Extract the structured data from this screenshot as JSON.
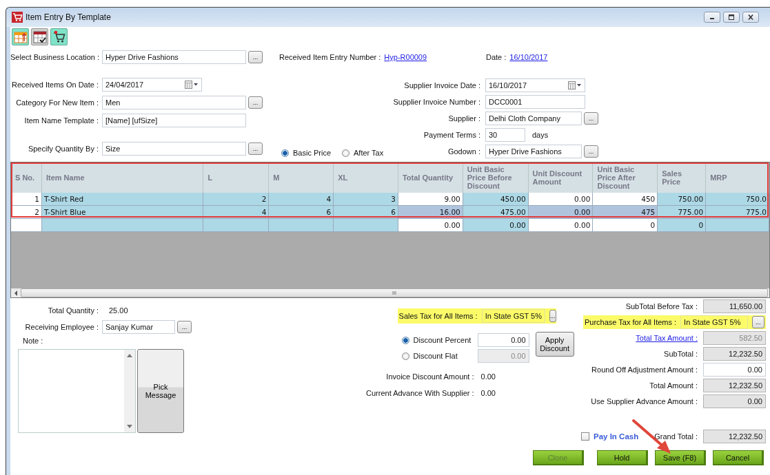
{
  "window": {
    "title": "Item Entry By Template"
  },
  "header_row": {
    "business_location": {
      "label": "Select Business Location :",
      "value": "Hyper Drive Fashions",
      "button": "..."
    },
    "entry_number": {
      "label": "Received Item Entry Number :",
      "value": "Hyp-R00009"
    },
    "date": {
      "label": "Date :",
      "value": "16/10/2017"
    }
  },
  "left_fields": [
    {
      "kind": "date",
      "label": "Received Items On Date :",
      "value": "24/04/2017"
    },
    {
      "kind": "text",
      "label": "Category  For New Item :",
      "value": "Men",
      "button": "..."
    },
    {
      "kind": "text",
      "label": "Item Name Template :",
      "value": "[Name]  [ufSize]"
    },
    {
      "kind": "text",
      "label": "Specify Quantity By :",
      "value": "Size",
      "button": "..."
    }
  ],
  "price_modes": [
    {
      "label": "Basic Price",
      "selected": true
    },
    {
      "label": "After Tax",
      "selected": false
    }
  ],
  "right_fields": [
    {
      "kind": "date",
      "label": "Supplier Invoice Date :",
      "value": "16/10/2017"
    },
    {
      "kind": "text",
      "label": "Supplier Invoice Number :",
      "value": "DCC0001"
    },
    {
      "kind": "text",
      "label": "Supplier :",
      "value": "Delhi Cloth Company",
      "button": "..."
    },
    {
      "kind": "short",
      "label": "Payment Terms :",
      "value": "30",
      "unit": "days"
    },
    {
      "kind": "text",
      "label": "Godown :",
      "value": "Hyper Drive Fashions",
      "button": "..."
    }
  ],
  "grid": {
    "highlighted": true,
    "columns": [
      {
        "label": "S No.",
        "kind": "index"
      },
      {
        "label": "Item Name",
        "kind": "name"
      },
      {
        "label": "L",
        "kind": "computed"
      },
      {
        "label": "M",
        "kind": "computed"
      },
      {
        "label": "XL",
        "kind": "computed"
      },
      {
        "label": "Total Quantity",
        "kind": "input"
      },
      {
        "label": "Unit Basic Price Before Discount",
        "kind": "computed"
      },
      {
        "label": "Unit Discount Amount",
        "kind": "input"
      },
      {
        "label": "Unit Basic Price After Discount",
        "kind": "input"
      },
      {
        "label": "Sales Price",
        "kind": "computed"
      },
      {
        "label": "MRP",
        "kind": "computed"
      }
    ],
    "rows": [
      {
        "selected": false,
        "cells": [
          "1",
          "T-Shirt Red",
          "2",
          "4",
          "3",
          "9.00",
          "450.00",
          "0.00",
          "450",
          "750.00",
          "750.0"
        ]
      },
      {
        "selected": true,
        "cells": [
          "2",
          "T-Shirt Blue",
          "4",
          "6",
          "6",
          "16.00",
          "475.00",
          "0.00",
          "475",
          "775.00",
          "775.0"
        ]
      },
      {
        "selected": false,
        "cells": [
          null,
          null,
          null,
          null,
          null,
          "0.00",
          "0.00",
          "0.00",
          "0",
          "0",
          null
        ]
      }
    ],
    "scrollbar": {
      "grip": "III"
    }
  },
  "summary": {
    "total_quantity": {
      "label": "Total Quantity :",
      "value": "25.00"
    },
    "employee": {
      "label": "Receiving Employee :",
      "value": "Sanjay Kumar",
      "button": "..."
    },
    "note": {
      "label": "Note :"
    },
    "pick_message": "Pick Message"
  },
  "sales_tax": {
    "label": "Sales Tax for All Items :",
    "value": "In State GST 5%",
    "button": "...",
    "highlighted": true
  },
  "discount_modes": [
    {
      "label": "Discount Percent",
      "selected": true,
      "value": "0.00",
      "disabled": false
    },
    {
      "label": "Discount Flat",
      "selected": false,
      "value": "0.00",
      "disabled": true
    }
  ],
  "apply_discount": "Apply Discount",
  "info": [
    {
      "label": "Invoice Discount Amount :",
      "value": "0.00"
    },
    {
      "label": "Current Advance With Supplier :",
      "value": "0.00"
    }
  ],
  "totals": [
    {
      "kind": "field",
      "label": "SubTotal Before Tax :",
      "value": "11,650.00",
      "disabled": true
    },
    {
      "kind": "tax",
      "label": "Purchase Tax for All Items :",
      "value": "In State GST 5%",
      "button": "...",
      "highlighted": true
    },
    {
      "kind": "link",
      "label": "Total Tax Amount :",
      "value": "582.50",
      "disabled": true
    },
    {
      "kind": "field",
      "label": "SubTotal :",
      "value": "12,232.50",
      "disabled": true
    },
    {
      "kind": "field",
      "label": "Round Off Adjustment Amount :",
      "value": "0.00",
      "disabled": false
    },
    {
      "kind": "field",
      "label": "Total Amount :",
      "value": "12,232.50",
      "disabled": true
    },
    {
      "kind": "field",
      "label": "Use Supplier Advance Amount :",
      "value": "0.00",
      "disabled": true
    }
  ],
  "pay_in_cash": {
    "label": "Pay In Cash",
    "checked": false
  },
  "grand_total": {
    "label": "Grand Total :",
    "value": "12,232.50"
  },
  "actions": [
    {
      "label": "Clone",
      "disabled": true
    },
    {
      "label": "Hold",
      "disabled": false
    },
    {
      "label": "Save (F8)",
      "disabled": false
    },
    {
      "label": "Cancel",
      "disabled": false
    }
  ]
}
